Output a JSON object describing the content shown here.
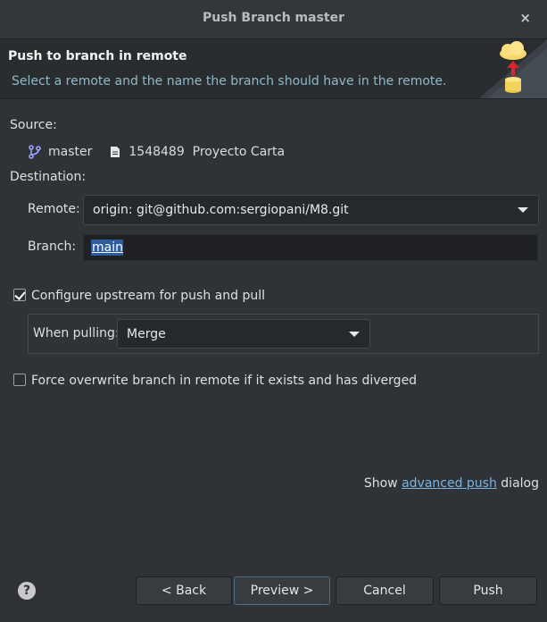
{
  "window": {
    "title": "Push Branch master",
    "close_glyph": "×"
  },
  "banner": {
    "title": "Push to branch in remote",
    "description": "Select a remote and the name the branch should have in the remote.",
    "graphic_icon": "cloud-push-icon"
  },
  "source": {
    "label": "Source:",
    "branch": "master",
    "commit": "1548489  Proyecto Carta",
    "branch_icon": "git-branch-icon",
    "commit_icon": "commit-file-icon"
  },
  "destination": {
    "label": "Destination:",
    "remote_label": "Remote:",
    "remote_value": "origin: git@github.com:sergiopani/M8.git",
    "branch_label": "Branch:",
    "branch_value": "main"
  },
  "upstream": {
    "checkbox_label": "Configure upstream for push and pull",
    "checked": true,
    "pulling_label": "When pulling:",
    "pulling_value": "Merge"
  },
  "force": {
    "checkbox_label": "Force overwrite branch in remote if it exists and has diverged",
    "checked": false
  },
  "advanced": {
    "prefix": "Show ",
    "link": "advanced push",
    "suffix": " dialog"
  },
  "buttons": {
    "help": "?",
    "back": "< Back",
    "preview": "Preview >",
    "cancel": "Cancel",
    "push": "Push"
  },
  "colors": {
    "background": "#2f3236",
    "accent_link": "#7cb4e0",
    "selection": "#2e5d9f",
    "description_text": "#8fb9c9"
  }
}
